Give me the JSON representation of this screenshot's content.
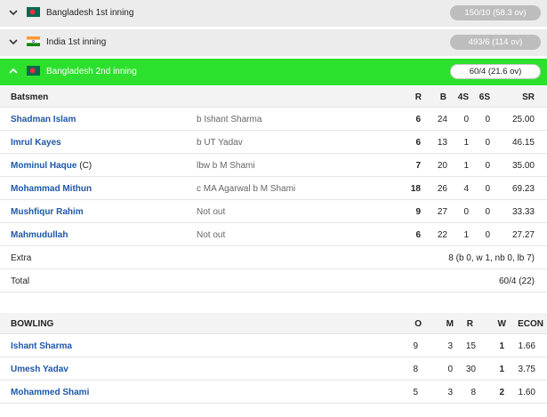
{
  "innings": [
    {
      "team": "Bangladesh 1st inning",
      "flag": "bangladesh-flag",
      "score": "150/10 (58.3 ov)",
      "expanded": false
    },
    {
      "team": "India 1st inning",
      "flag": "india-flag",
      "score": "493/6 (114 ov)",
      "expanded": false
    },
    {
      "team": "Bangladesh 2nd inning",
      "flag": "bangladesh-flag",
      "score": "60/4 (21.6 ov)",
      "expanded": true
    }
  ],
  "batting": {
    "headers": {
      "batsmen": "Batsmen",
      "r": "R",
      "b": "B",
      "fours": "4S",
      "sixes": "6S",
      "sr": "SR"
    },
    "rows": [
      {
        "name": "Shadman Islam",
        "captain": "",
        "dismissal": "b Ishant Sharma",
        "r": "6",
        "b": "24",
        "fours": "0",
        "sixes": "0",
        "sr": "25.00"
      },
      {
        "name": "Imrul Kayes",
        "captain": "",
        "dismissal": "b UT Yadav",
        "r": "6",
        "b": "13",
        "fours": "1",
        "sixes": "0",
        "sr": "46.15"
      },
      {
        "name": "Mominul Haque",
        "captain": "(C)",
        "dismissal": "lbw b M Shami",
        "r": "7",
        "b": "20",
        "fours": "1",
        "sixes": "0",
        "sr": "35.00"
      },
      {
        "name": "Mohammad Mithun",
        "captain": "",
        "dismissal": "c MA Agarwal b M Shami",
        "r": "18",
        "b": "26",
        "fours": "4",
        "sixes": "0",
        "sr": "69.23"
      },
      {
        "name": "Mushfiqur Rahim",
        "captain": "",
        "dismissal": "Not out",
        "r": "9",
        "b": "27",
        "fours": "0",
        "sixes": "0",
        "sr": "33.33"
      },
      {
        "name": "Mahmudullah",
        "captain": "",
        "dismissal": "Not out",
        "r": "6",
        "b": "22",
        "fours": "1",
        "sixes": "0",
        "sr": "27.27"
      }
    ],
    "extra": {
      "label": "Extra",
      "value": "8 (b 0, w 1, nb 0, lb 7)"
    },
    "total": {
      "label": "Total",
      "value": "60/4 (22)"
    }
  },
  "bowling": {
    "headers": {
      "bowling": "BOWLING",
      "o": "O",
      "m": "M",
      "r": "R",
      "w": "W",
      "econ": "ECON"
    },
    "rows": [
      {
        "name": "Ishant Sharma",
        "o": "9",
        "m": "3",
        "r": "15",
        "w": "1",
        "econ": "1.66"
      },
      {
        "name": "Umesh Yadav",
        "o": "8",
        "m": "0",
        "r": "30",
        "w": "1",
        "econ": "3.75"
      },
      {
        "name": "Mohammed Shami",
        "o": "5",
        "m": "3",
        "r": "8",
        "w": "2",
        "econ": "1.60"
      }
    ]
  },
  "colors": {
    "active_header": "#2ee02e",
    "name_link": "#1f57a8",
    "pill_grey": "#bdbdbd",
    "bangladesh_green": "#006a4e",
    "bangladesh_red": "#f42a41"
  }
}
